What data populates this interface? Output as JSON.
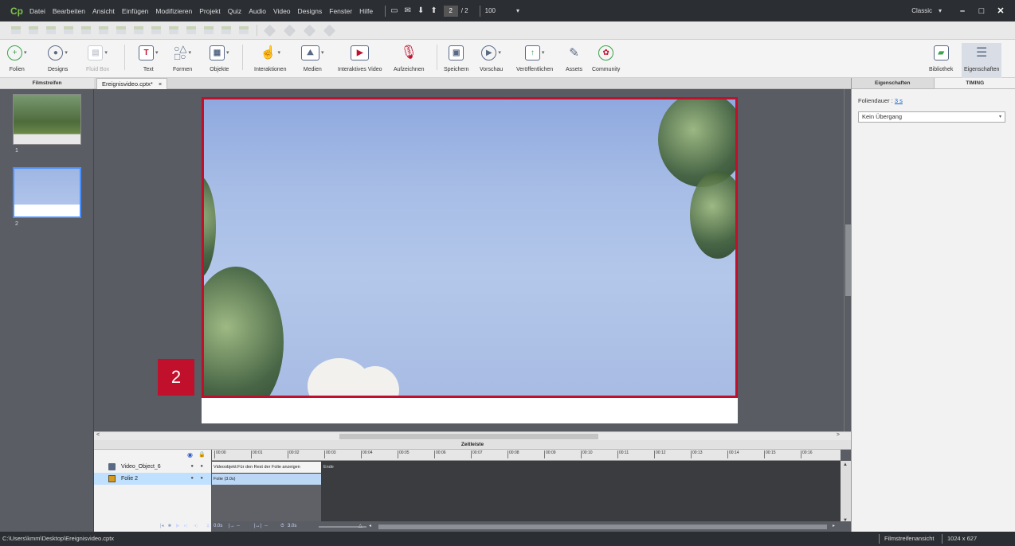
{
  "app": {
    "logo": "Cp"
  },
  "menu": [
    "Datei",
    "Bearbeiten",
    "Ansicht",
    "Einfügen",
    "Modifizieren",
    "Projekt",
    "Quiz",
    "Audio",
    "Video",
    "Designs",
    "Fenster",
    "Hilfe"
  ],
  "nav": {
    "current_page": "2",
    "total_pages": "/ 2",
    "zoom": "100"
  },
  "workspace": {
    "mode": "Classic"
  },
  "toolbar": {
    "folien": "Folien",
    "designs": "Designs",
    "fluidbox": "Fluid Box",
    "text": "Text",
    "formen": "Formen",
    "objekte": "Objekte",
    "interaktionen": "Interaktionen",
    "medien": "Medien",
    "interaktives_video": "Interaktives Video",
    "aufzeichnen": "Aufzeichnen",
    "speichern": "Speichern",
    "vorschau": "Vorschau",
    "veroeffentlichen": "Veröffentlichen",
    "assets": "Assets",
    "community": "Community",
    "bibliothek": "Bibliothek",
    "eigenschaften": "Eigenschaften"
  },
  "filmstrip": {
    "header": "Filmstreifen",
    "slides": [
      "1",
      "2"
    ]
  },
  "doc_tab": {
    "name": "Ereignisvideo.cptx*",
    "close": "×"
  },
  "slide": {
    "badge": "2"
  },
  "timeline": {
    "header": "Zeitleiste",
    "layers": [
      {
        "name": "Video_Object_6"
      },
      {
        "name": "Folie 2"
      }
    ],
    "ticks": [
      "00:00",
      "00:01",
      "00:02",
      "00:03",
      "00:04",
      "00:05",
      "00:06",
      "00:07",
      "00:08",
      "00:09",
      "00:10",
      "00:11",
      "00:12",
      "00:13",
      "00:14",
      "00:15",
      "00:16"
    ],
    "video_bar": "Videoobjekt:Für den Rest der Folie anzeigen",
    "slide_bar": "Folie (3.0s)",
    "end_label": "Ende",
    "footer_start": "0.0s",
    "footer_dash1": "--",
    "footer_dash2": "--",
    "footer_dur": "3.0s"
  },
  "props": {
    "tab_props": "Eigenschaften",
    "tab_timing": "TIMING",
    "duration_label": "Foliendauer :",
    "duration_value": "3 s",
    "transition": "Kein Übergang"
  },
  "status": {
    "path": "C:\\Users\\kmm\\Desktop\\Ereignisvideo.cptx",
    "view": "Filmstreifenansicht",
    "size": "1024 x 627"
  },
  "colors": {
    "accent": "#c1102b",
    "selection": "#4a90ff"
  }
}
